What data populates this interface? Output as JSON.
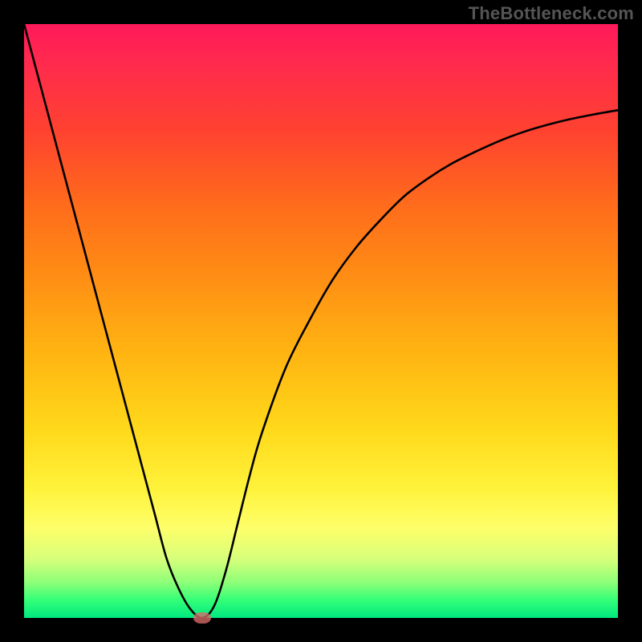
{
  "watermark": "TheBottleneck.com",
  "colors": {
    "curve_stroke": "#000000",
    "marker_fill": "#d86a6a",
    "background": "#000000"
  },
  "chart_data": {
    "type": "line",
    "title": "",
    "xlabel": "",
    "ylabel": "",
    "xlim": [
      0,
      100
    ],
    "ylim": [
      0,
      100
    ],
    "grid": false,
    "legend": false,
    "x": [
      0,
      2,
      4,
      6,
      8,
      10,
      12,
      14,
      16,
      18,
      20,
      22,
      24,
      26,
      28,
      30,
      32,
      34,
      36,
      38,
      40,
      44,
      48,
      52,
      56,
      60,
      64,
      68,
      72,
      76,
      80,
      84,
      88,
      92,
      96,
      100
    ],
    "values": [
      100,
      92.5,
      85,
      77.5,
      70,
      62.5,
      55,
      47.5,
      40,
      32.5,
      25,
      17.5,
      10,
      5,
      1.5,
      0,
      2,
      8,
      16,
      24,
      31,
      42,
      50,
      57,
      62.5,
      67,
      71,
      74,
      76.5,
      78.5,
      80.3,
      81.8,
      83,
      84,
      84.8,
      85.5
    ],
    "marker": {
      "x": 30,
      "y": 0
    },
    "note": "Values read off the plot: a steep linear descent from top-left, hitting zero near x≈30, then a steep rise decaying toward an asymptote around y≈86 at the right edge."
  }
}
